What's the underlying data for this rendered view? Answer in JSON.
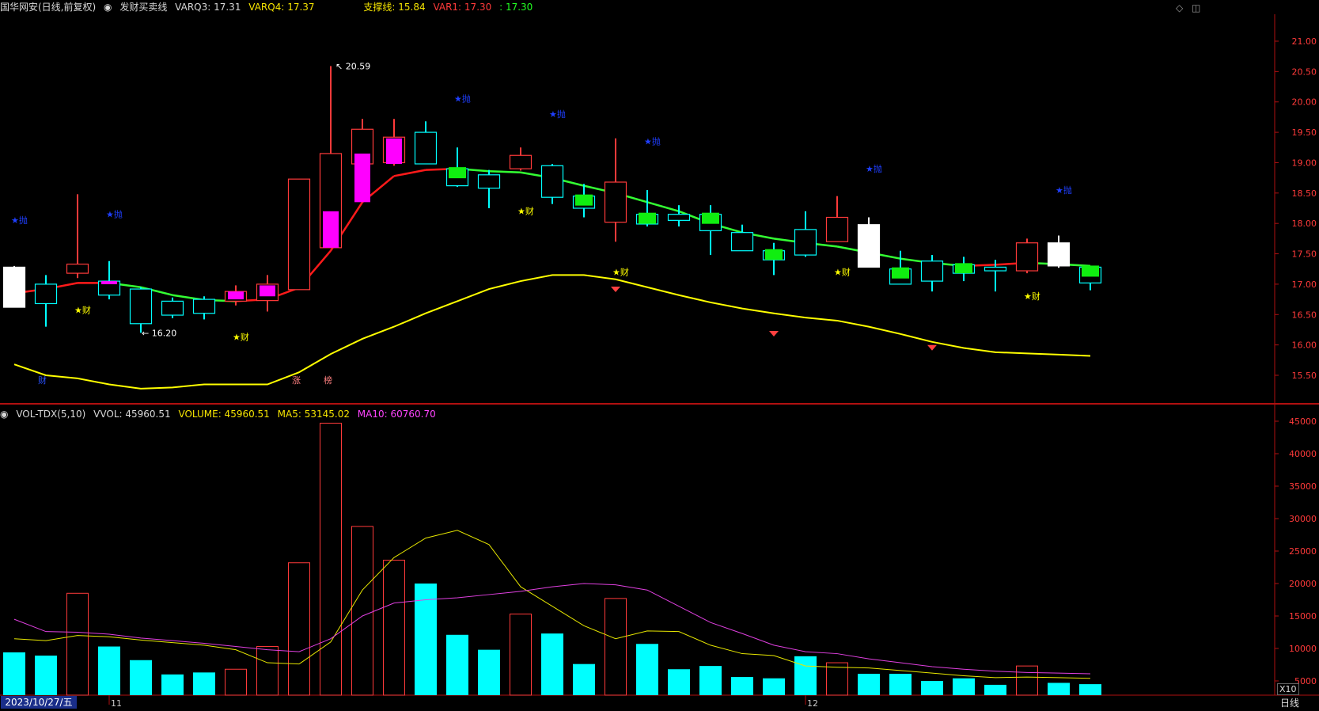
{
  "header": {
    "stock": "国华网安(日线,前复权)",
    "indicator_name": "发财买卖线",
    "varq3": "VARQ3: 17.31",
    "varq4": "VARQ4: 17.37",
    "support": "支撑线: 15.84",
    "var1_label": "VAR1: 17.30",
    "var1_value": ": 17.30"
  },
  "vol_header": {
    "name": "VOL-TDX(5,10)",
    "vvol": "VVOL: 45960.51",
    "volume": "VOLUME: 45960.51",
    "ma5": "MA5: 53145.02",
    "ma10": "MA10: 60760.70"
  },
  "controls": {
    "diamond": "◇",
    "settings": "◫"
  },
  "price_axis": [
    "21.00",
    "20.50",
    "20.00",
    "19.50",
    "19.00",
    "18.50",
    "18.00",
    "17.50",
    "17.00",
    "16.50",
    "16.00",
    "15.50"
  ],
  "vol_axis": [
    "45000",
    "40000",
    "35000",
    "30000",
    "25000",
    "20000",
    "15000",
    "10000",
    "5000"
  ],
  "annotations": {
    "high": "20.59",
    "low": "16.20",
    "mark_star_blue": "★抛",
    "mark_star_yellow": "★财",
    "mark_cai": "财",
    "mark_zhang": "涨",
    "mark_bang": "榜"
  },
  "colors": {
    "up": "#ff3a3a",
    "down_fill": "#00ffff",
    "white": "#ffffff",
    "magenta": "#ff00ff",
    "green": "#00ff00",
    "yellow": "#ffff00",
    "blue": "#1f3fff"
  },
  "footer": {
    "date": "2023/10/27/五",
    "month11": "11",
    "month12": "12",
    "period": "日线",
    "zoom": "X10"
  },
  "chart_data": {
    "type": "candlestick",
    "price_range": [
      15.2,
      21.3
    ],
    "volume_range": [
      0,
      47000
    ],
    "candles": [
      {
        "o": 17.28,
        "h": 17.3,
        "l": 16.62,
        "c": 16.62,
        "v": 9400,
        "s": "white"
      },
      {
        "o": 17.0,
        "h": 17.15,
        "l": 16.3,
        "c": 16.68,
        "v": 8900,
        "s": "cyan"
      },
      {
        "o": 17.18,
        "h": 18.48,
        "l": 17.1,
        "c": 17.33,
        "v": 18500,
        "s": "red"
      },
      {
        "o": 17.05,
        "h": 17.38,
        "l": 16.75,
        "c": 16.82,
        "v": 10300,
        "s": "cyan"
      },
      {
        "o": 16.92,
        "h": 16.95,
        "l": 16.2,
        "c": 16.35,
        "v": 8200,
        "s": "cyan"
      },
      {
        "o": 16.72,
        "h": 16.78,
        "l": 16.44,
        "c": 16.49,
        "v": 6000,
        "s": "cyan"
      },
      {
        "o": 16.75,
        "h": 16.8,
        "l": 16.42,
        "c": 16.52,
        "v": 6300,
        "s": "cyan"
      },
      {
        "o": 16.72,
        "h": 16.98,
        "l": 16.65,
        "c": 16.88,
        "v": 6800,
        "s": "red"
      },
      {
        "o": 16.73,
        "h": 17.15,
        "l": 16.55,
        "c": 17.0,
        "v": 10300,
        "s": "red"
      },
      {
        "o": 16.91,
        "h": 18.73,
        "l": 16.91,
        "c": 18.73,
        "v": 23200,
        "s": "red"
      },
      {
        "o": 17.6,
        "h": 20.59,
        "l": 17.6,
        "c": 19.15,
        "v": 44700,
        "s": "red"
      },
      {
        "o": 19.55,
        "h": 19.72,
        "l": 18.35,
        "c": 18.98,
        "v": 28800,
        "s": "red"
      },
      {
        "o": 19.0,
        "h": 19.72,
        "l": 18.95,
        "c": 19.42,
        "v": 23600,
        "s": "red"
      },
      {
        "o": 18.98,
        "h": 19.68,
        "l": 18.98,
        "c": 19.5,
        "v": 20000,
        "s": "cyan"
      },
      {
        "o": 18.9,
        "h": 19.25,
        "l": 18.6,
        "c": 18.62,
        "v": 12100,
        "s": "cyan"
      },
      {
        "o": 18.8,
        "h": 18.88,
        "l": 18.25,
        "c": 18.58,
        "v": 9800,
        "s": "cyan"
      },
      {
        "o": 18.9,
        "h": 19.25,
        "l": 18.87,
        "c": 19.12,
        "v": 15300,
        "s": "red"
      },
      {
        "o": 18.95,
        "h": 18.98,
        "l": 18.32,
        "c": 18.43,
        "v": 12300,
        "s": "cyan"
      },
      {
        "o": 18.45,
        "h": 18.65,
        "l": 18.1,
        "c": 18.25,
        "v": 7600,
        "s": "cyan"
      },
      {
        "o": 18.02,
        "h": 19.4,
        "l": 17.7,
        "c": 18.68,
        "v": 17700,
        "s": "red"
      },
      {
        "o": 18.15,
        "h": 18.55,
        "l": 17.95,
        "c": 17.99,
        "v": 10700,
        "s": "cyan"
      },
      {
        "o": 18.15,
        "h": 18.3,
        "l": 17.95,
        "c": 18.05,
        "v": 6800,
        "s": "cyan"
      },
      {
        "o": 18.15,
        "h": 18.3,
        "l": 17.48,
        "c": 17.88,
        "v": 7300,
        "s": "cyan"
      },
      {
        "o": 17.85,
        "h": 17.98,
        "l": 17.55,
        "c": 17.55,
        "v": 5600,
        "s": "cyan"
      },
      {
        "o": 17.55,
        "h": 17.68,
        "l": 17.15,
        "c": 17.4,
        "v": 5400,
        "s": "cyan"
      },
      {
        "o": 17.9,
        "h": 18.2,
        "l": 17.45,
        "c": 17.48,
        "v": 8800,
        "s": "cyan"
      },
      {
        "o": 18.1,
        "h": 18.45,
        "l": 17.72,
        "c": 17.7,
        "v": 7800,
        "s": "red"
      },
      {
        "o": 17.98,
        "h": 18.1,
        "l": 17.28,
        "c": 17.28,
        "v": 6100,
        "s": "white"
      },
      {
        "o": 17.25,
        "h": 17.55,
        "l": 17.05,
        "c": 17.0,
        "v": 6100,
        "s": "cyan"
      },
      {
        "o": 17.38,
        "h": 17.48,
        "l": 16.88,
        "c": 17.05,
        "v": 5000,
        "s": "cyan"
      },
      {
        "o": 17.32,
        "h": 17.45,
        "l": 17.05,
        "c": 17.18,
        "v": 5400,
        "s": "cyan"
      },
      {
        "o": 17.28,
        "h": 17.4,
        "l": 16.88,
        "c": 17.22,
        "v": 4400,
        "s": "cyan"
      },
      {
        "o": 17.22,
        "h": 17.75,
        "l": 17.18,
        "c": 17.68,
        "v": 7300,
        "s": "red"
      },
      {
        "o": 17.3,
        "h": 17.8,
        "l": 17.27,
        "c": 17.68,
        "v": 4700,
        "s": "white"
      },
      {
        "o": 17.02,
        "h": 17.3,
        "l": 16.9,
        "c": 17.28,
        "v": 4500,
        "s": "cyan"
      }
    ],
    "ma_red": [
      16.85,
      16.92,
      17.02,
      17.02,
      16.95,
      16.82,
      16.74,
      16.72,
      16.75,
      16.94,
      17.55,
      18.35,
      18.78,
      18.88,
      18.9,
      18.86,
      18.84,
      18.75,
      18.62,
      18.5,
      18.35,
      18.2,
      18.0,
      17.85,
      17.75,
      17.68,
      17.62,
      17.52,
      17.42,
      17.35,
      17.3,
      17.32,
      17.35,
      17.33,
      17.3
    ],
    "ma_yellow": [
      15.68,
      15.5,
      15.45,
      15.35,
      15.28,
      15.3,
      15.35,
      15.35,
      15.35,
      15.55,
      15.85,
      16.1,
      16.3,
      16.52,
      16.72,
      16.92,
      17.05,
      17.15,
      17.15,
      17.08,
      16.95,
      16.82,
      16.7,
      16.6,
      16.52,
      16.45,
      16.4,
      16.3,
      16.18,
      16.05,
      15.95,
      15.88,
      15.86,
      15.84,
      15.82
    ],
    "vol_ma5": [
      11500,
      11200,
      12000,
      11800,
      11300,
      10900,
      10500,
      9800,
      7800,
      7600,
      11000,
      19000,
      24000,
      27000,
      28200,
      26000,
      19500,
      16500,
      13500,
      11500,
      12700,
      12600,
      10500,
      9200,
      8900,
      7300,
      7100,
      7000,
      6600,
      6200,
      5800,
      5500,
      5600,
      5500,
      5400
    ],
    "vol_ma10": [
      14500,
      12600,
      12500,
      12200,
      11600,
      11200,
      10800,
      10300,
      9800,
      9500,
      11500,
      15000,
      17000,
      17500,
      17800,
      18300,
      18800,
      19500,
      20000,
      19800,
      19000,
      16500,
      14000,
      12300,
      10500,
      9500,
      9200,
      8400,
      7800,
      7200,
      6800,
      6500,
      6300,
      6200,
      6100
    ]
  }
}
